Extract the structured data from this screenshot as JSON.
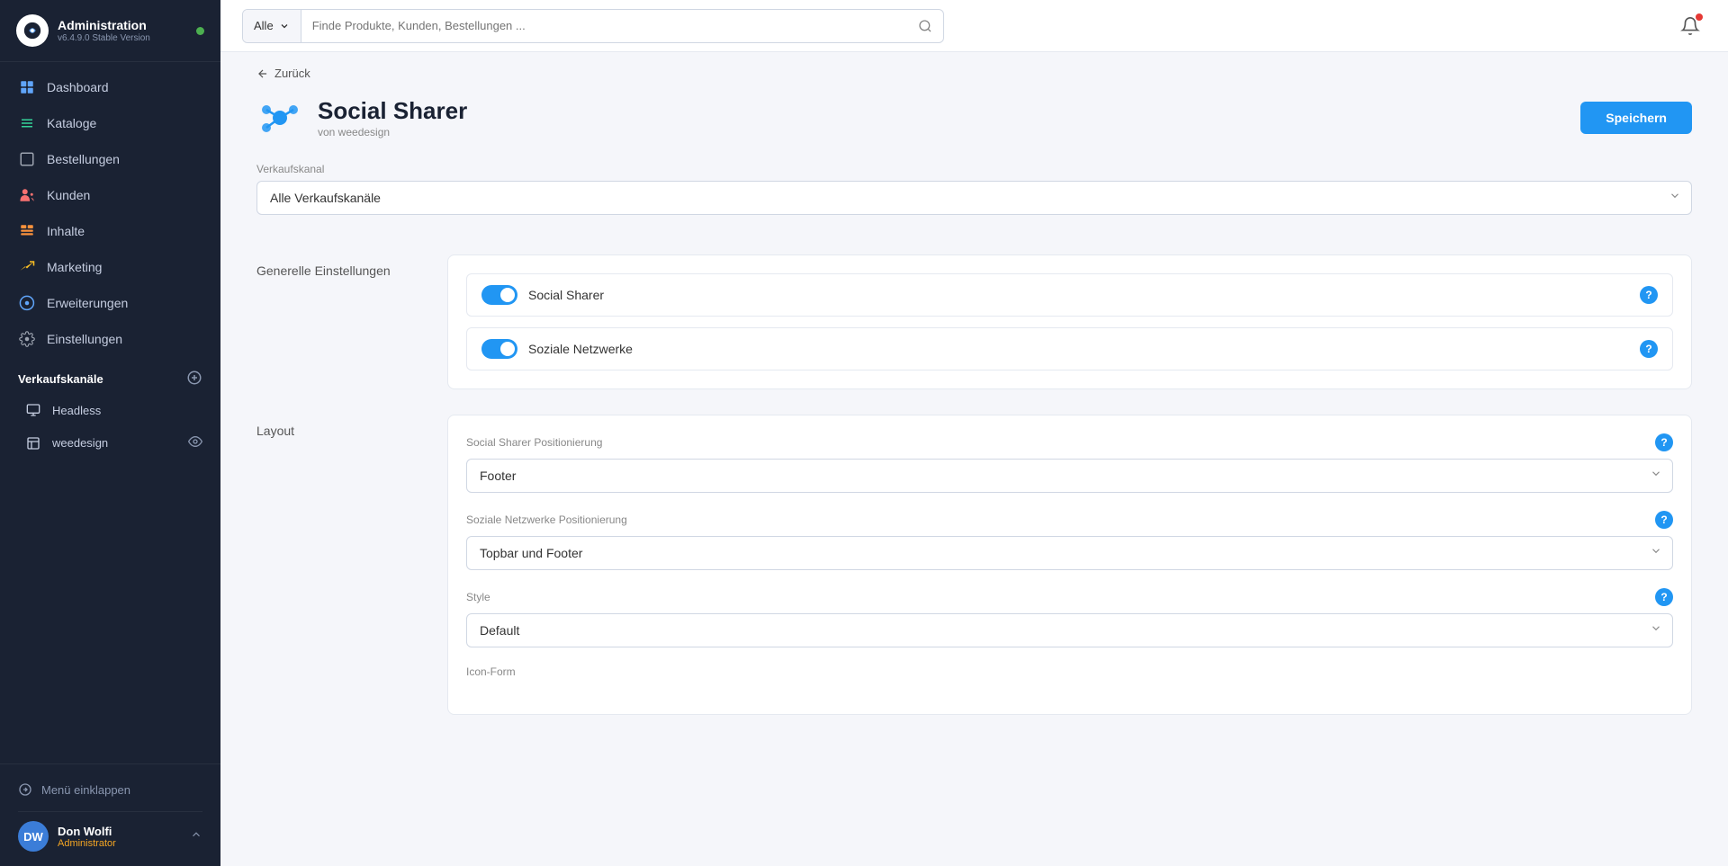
{
  "app": {
    "title": "Administration",
    "version": "v6.4.9.0 Stable Version"
  },
  "sidebar": {
    "nav_items": [
      {
        "id": "dashboard",
        "label": "Dashboard",
        "icon": "dashboard"
      },
      {
        "id": "kataloge",
        "label": "Kataloge",
        "icon": "kataloge"
      },
      {
        "id": "bestellungen",
        "label": "Bestellungen",
        "icon": "bestellungen"
      },
      {
        "id": "kunden",
        "label": "Kunden",
        "icon": "kunden"
      },
      {
        "id": "inhalte",
        "label": "Inhalte",
        "icon": "inhalte"
      },
      {
        "id": "marketing",
        "label": "Marketing",
        "icon": "marketing"
      },
      {
        "id": "erweiterungen",
        "label": "Erweiterungen",
        "icon": "erweiterungen"
      },
      {
        "id": "einstellungen",
        "label": "Einstellungen",
        "icon": "einstellungen"
      }
    ],
    "verkaufskanaele_label": "Verkaufskanäle",
    "sub_items": [
      {
        "id": "headless",
        "label": "Headless"
      },
      {
        "id": "weedesign",
        "label": "weedesign"
      }
    ],
    "collapse_label": "Menü einklappen",
    "user": {
      "initials": "DW",
      "name": "Don Wolfi",
      "role": "Administrator"
    }
  },
  "topbar": {
    "search_filter_label": "Alle",
    "search_placeholder": "Finde Produkte, Kunden, Bestellungen ..."
  },
  "back_label": "Zurück",
  "page": {
    "title": "Social Sharer",
    "author": "von weedesign",
    "save_button": "Speichern"
  },
  "sections": {
    "verkaufskanal": {
      "label": "Verkaufskanal",
      "dropdown_value": "Alle Verkaufskanäle"
    },
    "generelle_einstellungen": {
      "label": "Generelle Einstellungen",
      "toggles": [
        {
          "id": "social-sharer-toggle",
          "label": "Social Sharer",
          "enabled": true
        },
        {
          "id": "soziale-netzwerke-toggle",
          "label": "Soziale Netzwerke",
          "enabled": true
        }
      ]
    },
    "layout": {
      "label": "Layout",
      "fields": [
        {
          "id": "social-sharer-positionierung",
          "label": "Social Sharer Positionierung",
          "value": "Footer"
        },
        {
          "id": "soziale-netzwerke-positionierung",
          "label": "Soziale Netzwerke Positionierung",
          "value": "Topbar und Footer"
        },
        {
          "id": "style",
          "label": "Style",
          "value": "Default"
        },
        {
          "id": "icon-form",
          "label": "Icon-Form",
          "value": ""
        }
      ]
    }
  }
}
